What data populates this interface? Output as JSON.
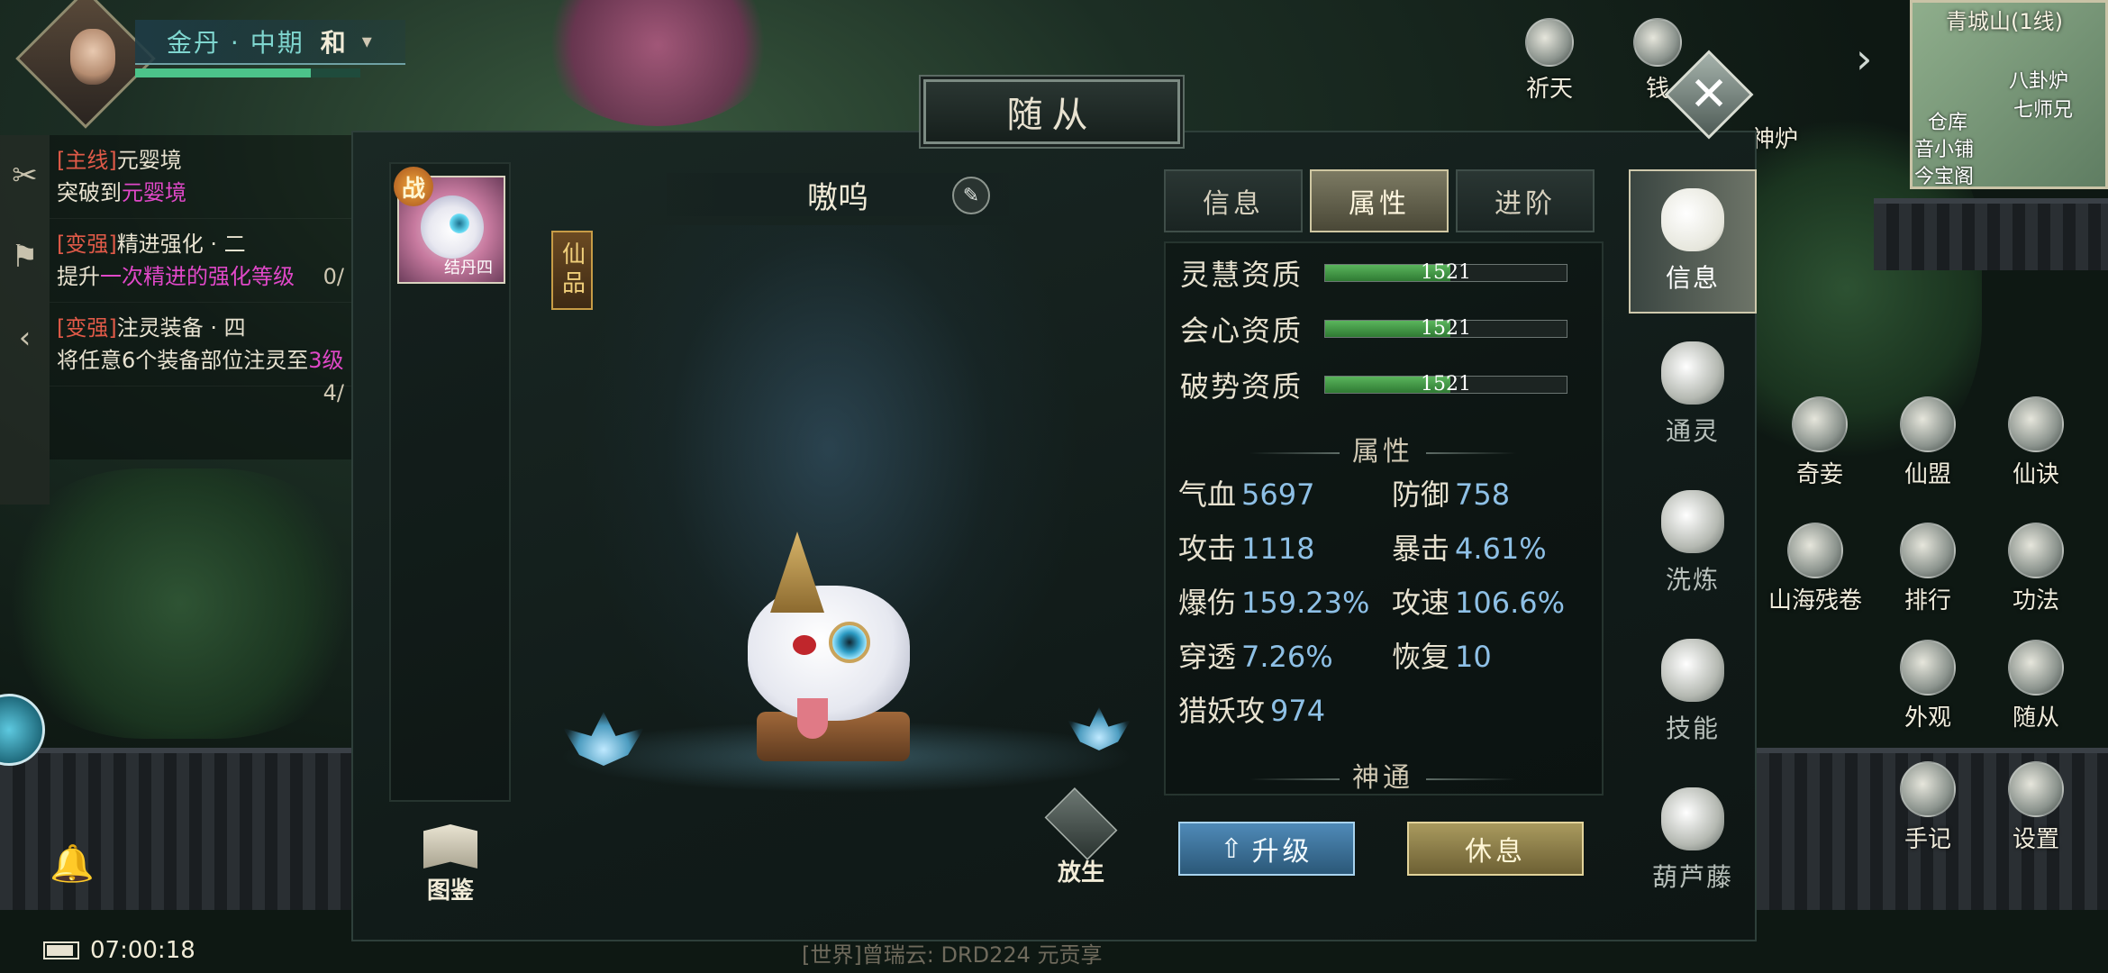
{
  "hud": {
    "realm": "金丹 · 中期",
    "mode": "和",
    "exp_fraction": 0.78,
    "clock": "07:00:18",
    "battery_fraction": 0.9,
    "chat_line": "[世界]曾瑞云: DRD224 元贡享"
  },
  "quests": [
    {
      "tag": "[主线]",
      "title": "元婴境",
      "desc_pre": "突破到",
      "desc_hi": "元婴境",
      "desc_post": "",
      "progress": ""
    },
    {
      "tag": "[变强]",
      "title": "精进强化 · 二",
      "desc_pre": "提升",
      "desc_hi": "一次",
      "desc_post": "精进的强化等级",
      "progress": "0/"
    },
    {
      "tag": "[变强]",
      "title": "注灵装备 · 四",
      "desc_pre": "将任意6个装备部位注灵至",
      "desc_hi": "3级",
      "desc_post": "",
      "progress": "4/"
    }
  ],
  "panel": {
    "title": "随从",
    "close_icon": "close-icon",
    "pet_name": "嗷呜",
    "roster_badge": "战",
    "roster_name": "结丹四",
    "grade": "仙品",
    "atlas_label": "图鉴",
    "release_label": "放生",
    "upgrade_label": "升级",
    "rest_label": "休息"
  },
  "tabs": [
    {
      "label": "信息",
      "active": false
    },
    {
      "label": "属性",
      "active": true
    },
    {
      "label": "进阶",
      "active": false
    }
  ],
  "aptitudes": [
    {
      "label": "灵慧资质",
      "value": "1521",
      "fraction": 0.52
    },
    {
      "label": "会心资质",
      "value": "1521",
      "fraction": 0.52
    },
    {
      "label": "破势资质",
      "value": "1521",
      "fraction": 0.52
    }
  ],
  "attributes_header": "属性",
  "attributes": [
    {
      "label": "气血",
      "value": "5697"
    },
    {
      "label": "防御",
      "value": "758"
    },
    {
      "label": "攻击",
      "value": "1118"
    },
    {
      "label": "暴击",
      "value": "4.61%"
    },
    {
      "label": "爆伤",
      "value": "159.23%"
    },
    {
      "label": "攻速",
      "value": "106.6%"
    },
    {
      "label": "穿透",
      "value": "7.26%"
    },
    {
      "label": "恢复",
      "value": "10"
    },
    {
      "label": "猎妖攻",
      "value": "974"
    }
  ],
  "skills_header": "神通",
  "side_tabs": [
    {
      "label": "信息",
      "active": true
    },
    {
      "label": "通灵",
      "active": false
    },
    {
      "label": "洗炼",
      "active": false
    },
    {
      "label": "技能",
      "active": false
    },
    {
      "label": "葫芦藤",
      "active": false
    }
  ],
  "top_hud": [
    {
      "label": "祈天"
    },
    {
      "label": "钱"
    },
    {
      "label": "神炉"
    }
  ],
  "right_hud": [
    {
      "label": "奇妾"
    },
    {
      "label": "仙盟"
    },
    {
      "label": "仙诀"
    },
    {
      "label": "山海残卷"
    },
    {
      "label": "排行"
    },
    {
      "label": "功法"
    },
    {
      "label": "外观"
    },
    {
      "label": "随从"
    },
    {
      "label": "手记"
    },
    {
      "label": "设置"
    }
  ],
  "minimap": {
    "title": "青城山(1线)",
    "labels": [
      "八卦炉",
      "七师兄",
      "仓库",
      "音小铺",
      "今宝阁"
    ]
  }
}
